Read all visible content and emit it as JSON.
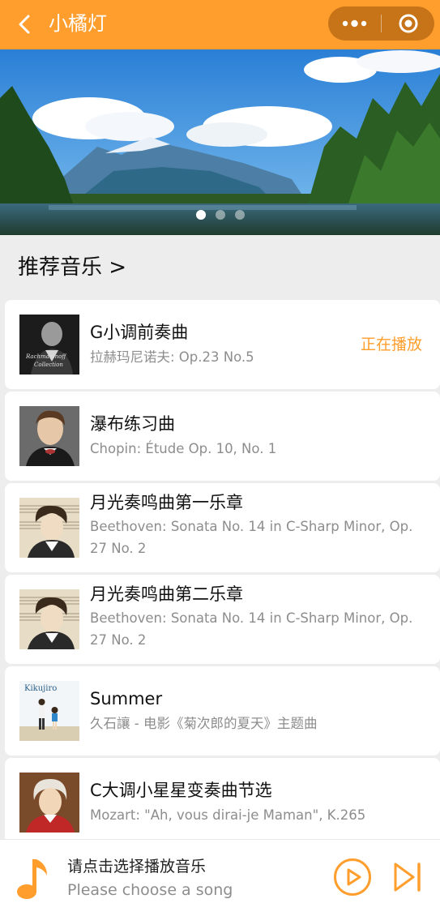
{
  "header": {
    "title": "小橘灯"
  },
  "section": {
    "title": "推荐音乐 >"
  },
  "songs": [
    {
      "name": "G小调前奏曲",
      "artist": "拉赫玛尼诺夫: Op.23 No.5",
      "status": "正在播放"
    },
    {
      "name": "瀑布练习曲",
      "artist": "Chopin: Étude Op. 10, No. 1"
    },
    {
      "name": "月光奏鸣曲第一乐章",
      "artist": "Beethoven: Sonata No. 14 in C-Sharp Minor, Op. 27 No. 2"
    },
    {
      "name": "月光奏鸣曲第二乐章",
      "artist": "Beethoven: Sonata No. 14 in C-Sharp Minor, Op. 27 No. 2"
    },
    {
      "name": "Summer",
      "artist": "久石讓 - 电影《菊次郎的夏天》主题曲",
      "cover_text": "Kikujiro"
    },
    {
      "name": "C大调小星星变奏曲节选",
      "artist": "Mozart: \"Ah, vous dirai-je Maman\", K.265"
    }
  ],
  "player": {
    "title": "请点击选择播放音乐",
    "subtitle": "Please choose a song"
  },
  "colors": {
    "accent": "#ff9e2d",
    "capsule": "#c77318",
    "background": "#ededed"
  }
}
